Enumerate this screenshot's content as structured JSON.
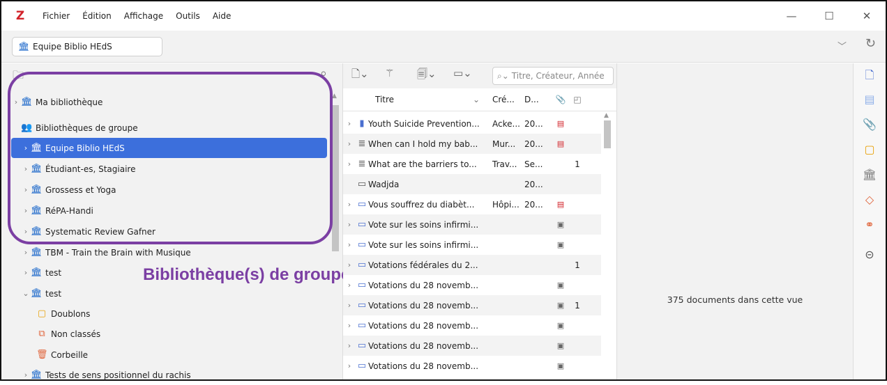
{
  "app": {
    "logo": "Z",
    "menu": [
      "Fichier",
      "Édition",
      "Affichage",
      "Outils",
      "Aide"
    ],
    "window_controls": {
      "minimize": "—",
      "maximize": "☐",
      "close": "✕"
    }
  },
  "tabbar": {
    "active_tab": "Equipe Biblio HEdS"
  },
  "collections": [
    {
      "label": "Ma bibliothèque",
      "twisty": "›",
      "icon": "library-icon"
    },
    {
      "label": "Bibliothèques de groupe",
      "twisty": "",
      "icon": "group-icon"
    },
    {
      "label": "Equipe Biblio HEdS",
      "twisty": "›",
      "icon": "library-icon",
      "selected": true
    },
    {
      "label": "Étudiant-es, Stagiaire",
      "twisty": "›",
      "icon": "library-icon"
    },
    {
      "label": "Grossess et Yoga",
      "twisty": "›",
      "icon": "library-icon"
    },
    {
      "label": "RéPA-Handi",
      "twisty": "›",
      "icon": "library-icon"
    },
    {
      "label": "Systematic Review Gafner",
      "twisty": "›",
      "icon": "library-icon"
    },
    {
      "label": "TBM - Train the Brain with Musique",
      "twisty": "›",
      "icon": "library-icon"
    },
    {
      "label": "test",
      "twisty": "›",
      "icon": "library-icon"
    },
    {
      "label": "test",
      "twisty": "⌄",
      "icon": "library-icon"
    },
    {
      "label": "Doublons",
      "twisty": "",
      "icon": "duplicates-icon"
    },
    {
      "label": "Non classés",
      "twisty": "",
      "icon": "unfiled-icon"
    },
    {
      "label": "Corbeille",
      "twisty": "",
      "icon": "trash-icon"
    },
    {
      "label": "Tests de sens positionnel du rachis",
      "twisty": "›",
      "icon": "library-icon"
    }
  ],
  "annotation": {
    "label": "Bibliothèque(s) de groupe",
    "color": "#7b3fa3"
  },
  "search": {
    "placeholder": "Titre, Créateur, Année"
  },
  "columns": {
    "title": "Titre",
    "creator": "Cré...",
    "date": "D..."
  },
  "items": [
    {
      "twisty": "›",
      "icon": "book-icon",
      "title": "Youth Suicide Prevention...",
      "creator": "Acke...",
      "date": "20...",
      "attach": "pdf",
      "notes": ""
    },
    {
      "twisty": "›",
      "icon": "article-icon",
      "title": "When can I hold my bab...",
      "creator": "Mur...",
      "date": "20...",
      "attach": "pdf",
      "notes": ""
    },
    {
      "twisty": "›",
      "icon": "article-icon",
      "title": "What are the barriers to...",
      "creator": "Trav...",
      "date": "Se...",
      "attach": "",
      "notes": "1"
    },
    {
      "twisty": "",
      "icon": "film-icon",
      "title": "Wadjda",
      "creator": "",
      "date": "20...",
      "attach": "",
      "notes": ""
    },
    {
      "twisty": "›",
      "icon": "webpage-icon",
      "title": "Vous souffrez du diabèt...",
      "creator": "Hôpi...",
      "date": "20...",
      "attach": "pdf",
      "notes": ""
    },
    {
      "twisty": "›",
      "icon": "webpage-icon",
      "title": "Vote sur les soins infirmi...",
      "creator": "",
      "date": "",
      "attach": "snapshot",
      "notes": ""
    },
    {
      "twisty": "›",
      "icon": "webpage-icon",
      "title": "Vote sur les soins infirmi...",
      "creator": "",
      "date": "",
      "attach": "snapshot",
      "notes": ""
    },
    {
      "twisty": "›",
      "icon": "webpage-icon",
      "title": "Votations fédérales du 2...",
      "creator": "",
      "date": "",
      "attach": "",
      "notes": "1"
    },
    {
      "twisty": "›",
      "icon": "webpage-icon",
      "title": "Votations du 28 novemb...",
      "creator": "",
      "date": "",
      "attach": "snapshot",
      "notes": ""
    },
    {
      "twisty": "›",
      "icon": "webpage-icon",
      "title": "Votations du 28 novemb...",
      "creator": "",
      "date": "",
      "attach": "snapshot",
      "notes": "1"
    },
    {
      "twisty": "›",
      "icon": "webpage-icon",
      "title": "Votations du 28 novemb...",
      "creator": "",
      "date": "",
      "attach": "snapshot",
      "notes": ""
    },
    {
      "twisty": "›",
      "icon": "webpage-icon",
      "title": "Votations du 28 novemb...",
      "creator": "",
      "date": "",
      "attach": "snapshot",
      "notes": ""
    },
    {
      "twisty": "›",
      "icon": "webpage-icon",
      "title": "Votations du 28 novemb...",
      "creator": "",
      "date": "",
      "attach": "snapshot",
      "notes": ""
    }
  ],
  "item_pane": {
    "count_text": "375 documents dans cette vue"
  },
  "colors": {
    "selection": "#3c6fdc",
    "library_icon": "#1865c9",
    "pdf": "#d2232a"
  }
}
